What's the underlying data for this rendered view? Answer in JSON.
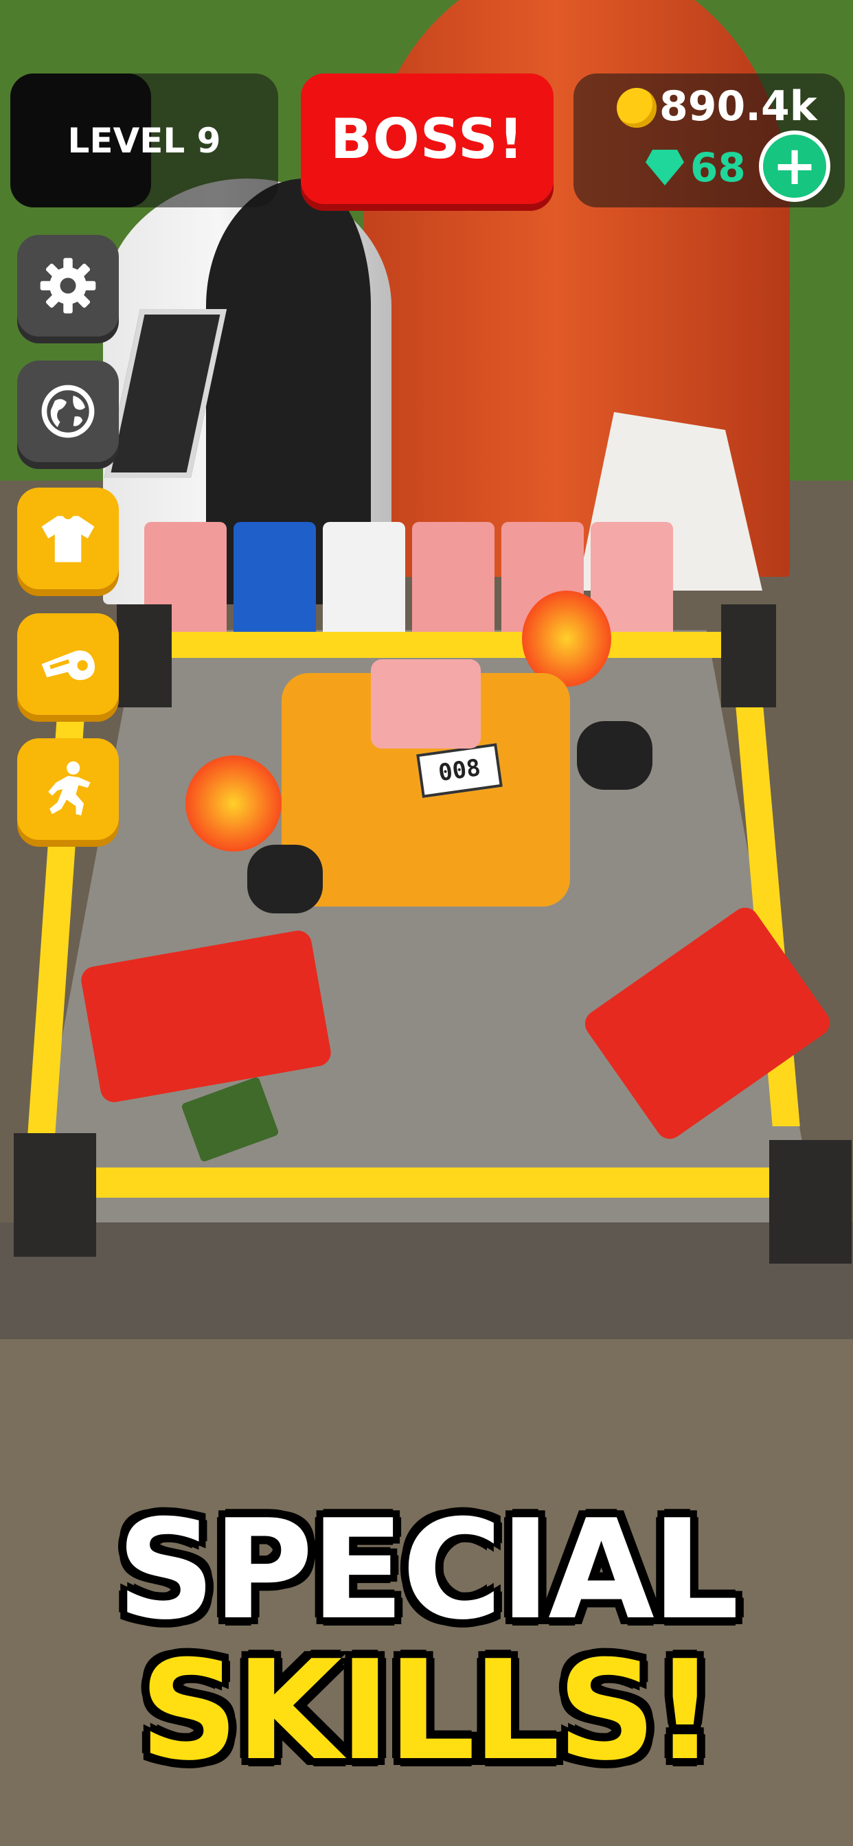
{
  "hud": {
    "level_label": "LEVEL 9",
    "boss_label": "BOSS!",
    "coins": "890.4k",
    "gems": "68",
    "add_label": "+"
  },
  "side_menu": [
    {
      "icon": "gear-icon",
      "style": "grey"
    },
    {
      "icon": "globe-icon",
      "style": "grey"
    },
    {
      "icon": "shirt-icon",
      "style": "yellow"
    },
    {
      "icon": "whistle-icon",
      "style": "yellow"
    },
    {
      "icon": "boxer-icon",
      "style": "yellow"
    }
  ],
  "scene": {
    "fighter_number": "008"
  },
  "promo": {
    "line1": "SPECIAL",
    "line2": "SKILLS!"
  },
  "colors": {
    "boss_red": "#ef1111",
    "coin_gold": "#ffcb13",
    "gem_green": "#1fd69b",
    "menu_yellow": "#f9b708",
    "promo_yellow": "#ffdf12"
  }
}
